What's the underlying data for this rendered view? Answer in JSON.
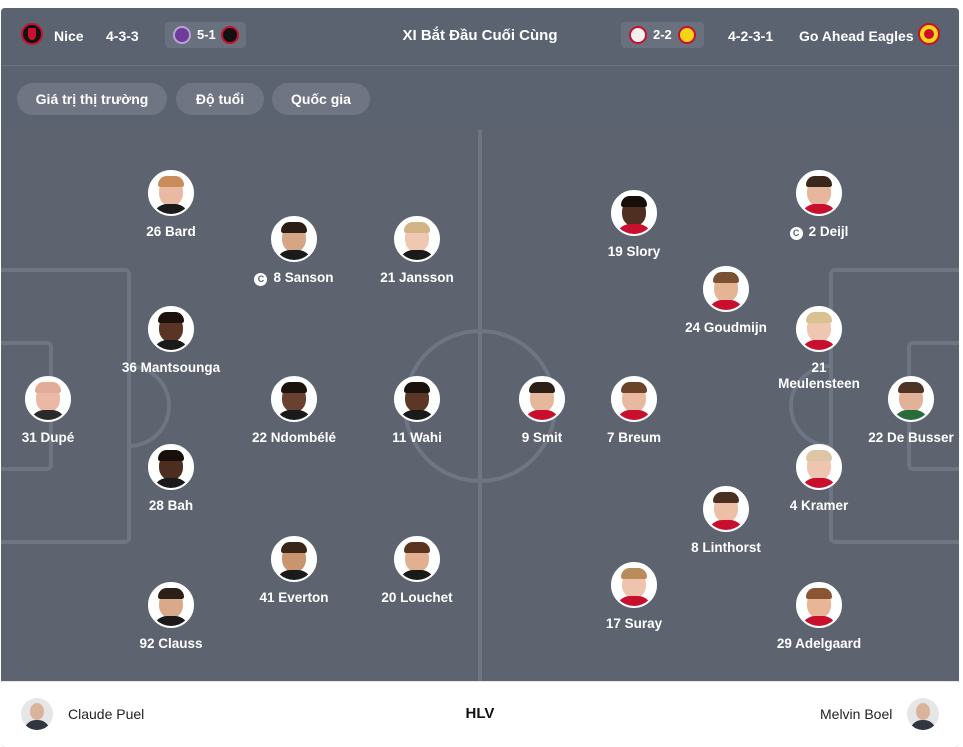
{
  "header": {
    "home_team": "Nice",
    "home_formation": "4-3-3",
    "home_last": "5-1",
    "title": "XI Bắt Đầu Cuối Cùng",
    "away_last": "2-2",
    "away_formation": "4-2-3-1",
    "away_team": "Go Ahead Eagles"
  },
  "filters": [
    "Giá trị thị trường",
    "Độ tuổi",
    "Quốc gia"
  ],
  "home_players": [
    {
      "label": "26 Bard",
      "skin": "#e8b9a3",
      "hair": "#c98c5a",
      "shirt": "#1a1a1a"
    },
    {
      "label": "8 Sanson",
      "captain": true,
      "skin": "#d5a685",
      "hair": "#2a1e16",
      "shirt": "#1a1a1a"
    },
    {
      "label": "21 Jansson",
      "skin": "#f0c7b0",
      "hair": "#d2b486",
      "shirt": "#1a1a1a"
    },
    {
      "label": "36 Mantsounga",
      "skin": "#5a3526",
      "hair": "#1b120d",
      "shirt": "#1a1a1a"
    },
    {
      "label": "31 Dupé",
      "skin": "#ebb8a6",
      "hair": "#e2ac98",
      "shirt": "#2a2a2a"
    },
    {
      "label": "22 Ndombélé",
      "skin": "#6a4030",
      "hair": "#1c130e",
      "shirt": "#1a1a1a"
    },
    {
      "label": "11 Wahi",
      "skin": "#5c3726",
      "hair": "#1a120d",
      "shirt": "#1a1a1a"
    },
    {
      "label": "28 Bah",
      "skin": "#4d2d20",
      "hair": "#180f0a",
      "shirt": "#1a1a1a"
    },
    {
      "label": "41 Everton",
      "skin": "#c9956f",
      "hair": "#3a2618",
      "shirt": "#1a1a1a"
    },
    {
      "label": "20 Louchet",
      "skin": "#e0b091",
      "hair": "#5a341f",
      "shirt": "#1a1a1a"
    },
    {
      "label": "92 Clauss",
      "skin": "#d9a98a",
      "hair": "#2b1f17",
      "shirt": "#1a1a1a"
    }
  ],
  "away_players": [
    {
      "label": "9 Smit",
      "skin": "#e6b89b",
      "hair": "#2c1f17",
      "shirt": "#c8102e"
    },
    {
      "label": "19 Slory",
      "skin": "#4f2f21",
      "hair": "#160e0a",
      "shirt": "#c8102e"
    },
    {
      "label": "7 Breum",
      "skin": "#e8b9a0",
      "hair": "#6a4328",
      "shirt": "#c8102e"
    },
    {
      "label": "17 Suray",
      "skin": "#efc4ac",
      "hair": "#b88c5d",
      "shirt": "#c8102e"
    },
    {
      "label": "24 Goudmijn",
      "skin": "#e5b495",
      "hair": "#7a5232",
      "shirt": "#c8102e"
    },
    {
      "label": "8 Linthorst",
      "skin": "#ecbfa6",
      "hair": "#4a3020",
      "shirt": "#c8102e"
    },
    {
      "label": "2 Deijl",
      "captain": true,
      "skin": "#e6b79c",
      "hair": "#3a281c",
      "shirt": "#c8102e"
    },
    {
      "label": "21 Meulensteen",
      "skin": "#efc7b1",
      "hair": "#d9c190",
      "shirt": "#c8102e"
    },
    {
      "label": "4 Kramer",
      "skin": "#efc5b0",
      "hair": "#dcc6a6",
      "shirt": "#c8102e"
    },
    {
      "label": "29 Adelgaard",
      "skin": "#e8b596",
      "hair": "#8a5533",
      "shirt": "#c8102e"
    },
    {
      "label": "22 De Busser",
      "skin": "#e2b298",
      "hair": "#4d3424",
      "shirt": "#2a6b3a"
    }
  ],
  "footer": {
    "home_coach": "Claude Puel",
    "label": "HLV",
    "away_coach": "Melvin Boel"
  },
  "colors": {
    "header_bg": "#5b6270",
    "pitch_bg": "#5d6470",
    "pill_bg": "#6f7582",
    "lines": "#6e7583"
  }
}
